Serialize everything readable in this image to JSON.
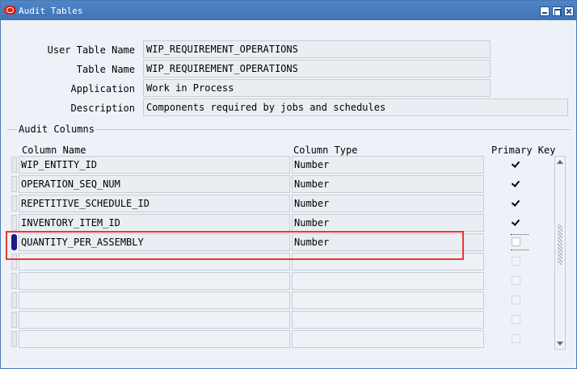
{
  "window": {
    "title": "Audit Tables"
  },
  "header": {
    "user_table_name": {
      "label": "User Table Name",
      "value": "WIP_REQUIREMENT_OPERATIONS"
    },
    "table_name": {
      "label": "Table Name",
      "value": "WIP_REQUIREMENT_OPERATIONS"
    },
    "application": {
      "label": "Application",
      "value": "Work in Process"
    },
    "description": {
      "label": "Description",
      "value": "Components required by jobs and schedules"
    }
  },
  "audit_columns": {
    "section_label": "Audit Columns",
    "headers": {
      "column_name": "Column Name",
      "column_type": "Column Type",
      "primary_key": "Primary Key"
    },
    "rows": [
      {
        "column_name": "WIP_ENTITY_ID",
        "column_type": "Number",
        "primary_key": true
      },
      {
        "column_name": "OPERATION_SEQ_NUM",
        "column_type": "Number",
        "primary_key": true
      },
      {
        "column_name": "REPETITIVE_SCHEDULE_ID",
        "column_type": "Number",
        "primary_key": true
      },
      {
        "column_name": "INVENTORY_ITEM_ID",
        "column_type": "Number",
        "primary_key": true
      },
      {
        "column_name": "QUANTITY_PER_ASSEMBLY",
        "column_type": "Number",
        "primary_key": false
      },
      {
        "column_name": "",
        "column_type": "",
        "primary_key": false
      },
      {
        "column_name": "",
        "column_type": "",
        "primary_key": false
      },
      {
        "column_name": "",
        "column_type": "",
        "primary_key": false
      },
      {
        "column_name": "",
        "column_type": "",
        "primary_key": false
      },
      {
        "column_name": "",
        "column_type": "",
        "primary_key": false
      }
    ]
  },
  "colors": {
    "titlebar": "#4f86c8",
    "highlight": "#e53935",
    "window_bg": "#eef2f8"
  },
  "icons": {
    "app": "oracle-logo-icon",
    "scroll_up": "chevron-up-icon",
    "scroll_down": "chevron-down-icon"
  }
}
